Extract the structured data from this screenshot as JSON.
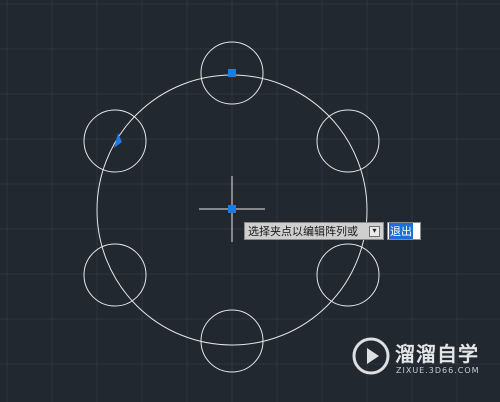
{
  "command_prompt": {
    "text": "选择夹点以编辑阵列或",
    "dropdown_icon": "down-arrow-icon",
    "option_exit": "退出"
  },
  "watermark": {
    "title": "溜溜自学",
    "subtitle": "ZIXUE.3D66.COM",
    "logo_icon": "play-logo-icon"
  },
  "colors": {
    "background": "#212830",
    "grid_line": "#2d3540",
    "geometry": "#e6e6e6",
    "grip": "#1e7be0",
    "selection_highlight": "#1c6fd8"
  }
}
